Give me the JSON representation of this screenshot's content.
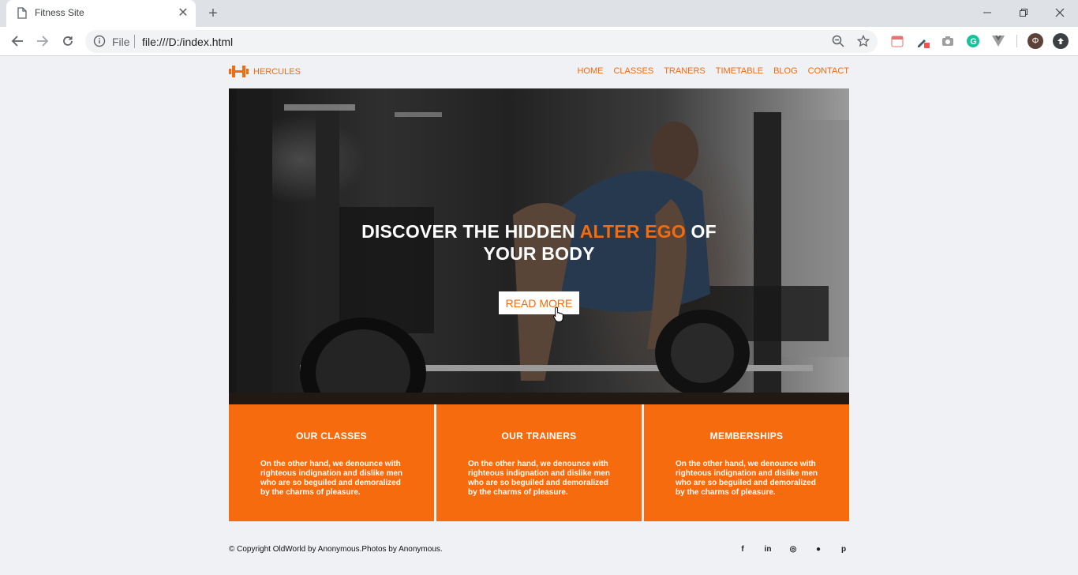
{
  "browser": {
    "tab_title": "Fitness Site",
    "scheme_label": "File",
    "url": "file:///D:/index.html",
    "profile_initial": "Φ"
  },
  "site": {
    "logo_text": "HERCULES",
    "nav": [
      "HOME",
      "CLASSES",
      "TRANERS",
      "TIMETABLE",
      "BLOG",
      "CONTACT"
    ],
    "hero": {
      "heading_before": "DISCOVER THE HIDDEN ",
      "heading_accent": "ALTER EGO",
      "heading_after": " OF YOUR BODY",
      "button_label": "READ MORE"
    },
    "features": [
      {
        "title": "OUR CLASSES",
        "text": "On the other hand, we denounce with righteous indignation and dislike men who are so beguiled and demoralized by the charms of pleasure."
      },
      {
        "title": "OUR TRAINERS",
        "text": "On the other hand, we denounce with righteous indignation and dislike men who are so beguiled and demoralized by the charms of pleasure."
      },
      {
        "title": "MEMBERSHIPS",
        "text": "On the other hand, we denounce with righteous indignation and dislike men who are so beguiled and demoralized by the charms of pleasure."
      }
    ],
    "footer": {
      "copyright": "© Copyright OldWorld by Anonymous.Photos by Anonymous.",
      "social": [
        "facebook-icon",
        "linkedin-icon",
        "instagram-icon",
        "github-icon",
        "pinterest-icon"
      ],
      "social_glyphs": [
        "f",
        "in",
        "◎",
        "●",
        "p"
      ]
    },
    "colors": {
      "accent": "#f26b0f",
      "feature_bg": "#f66b0e",
      "page_bg": "#eff1f5"
    }
  }
}
